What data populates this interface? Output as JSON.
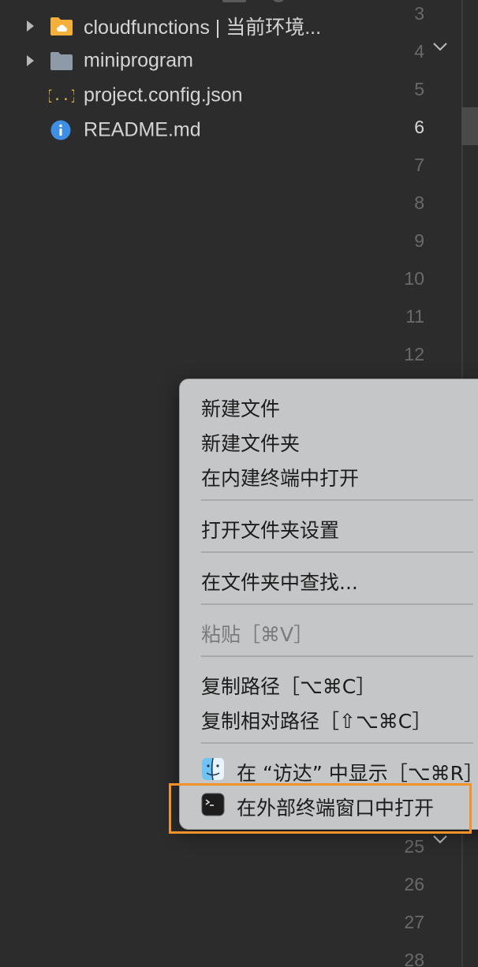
{
  "explorer": {
    "items": [
      {
        "label": "cloudfunctions | 当前环境...",
        "icon": "cloud-folder-icon",
        "expandable": true
      },
      {
        "label": "miniprogram",
        "icon": "folder-icon",
        "expandable": true
      },
      {
        "label": "project.config.json",
        "icon": "json-file-icon",
        "expandable": false
      },
      {
        "label": "README.md",
        "icon": "info-icon",
        "expandable": false
      }
    ]
  },
  "editor": {
    "line_numbers": [
      "3",
      "4",
      "5",
      "6",
      "7",
      "8",
      "9",
      "10",
      "11",
      "12",
      "25",
      "26",
      "27",
      "28"
    ],
    "active_line": "6"
  },
  "context_menu": {
    "items": {
      "new_file": "新建文件",
      "new_folder": "新建文件夹",
      "open_in_builtin_terminal": "在内建终端中打开",
      "folder_settings": "打开文件夹设置",
      "find_in_folder": "在文件夹中查找...",
      "paste": "粘贴［⌘V］",
      "copy_path": "复制路径［⌥⌘C］",
      "copy_relative_path": "复制相对路径［⇧⌥⌘C］",
      "reveal_in_finder": "在 “访达” 中显示［⌥⌘R］",
      "open_in_external_terminal": "在外部终端窗口中打开"
    }
  },
  "colors": {
    "background": "#2c2c2d",
    "menu_background": "#c5c6c8",
    "highlight": "#f3922a",
    "folder_yellow": "#f5b03c",
    "folder_gray": "#8e9aa8",
    "info_blue": "#3d8fe6",
    "json_yellow": "#e6b34a"
  }
}
